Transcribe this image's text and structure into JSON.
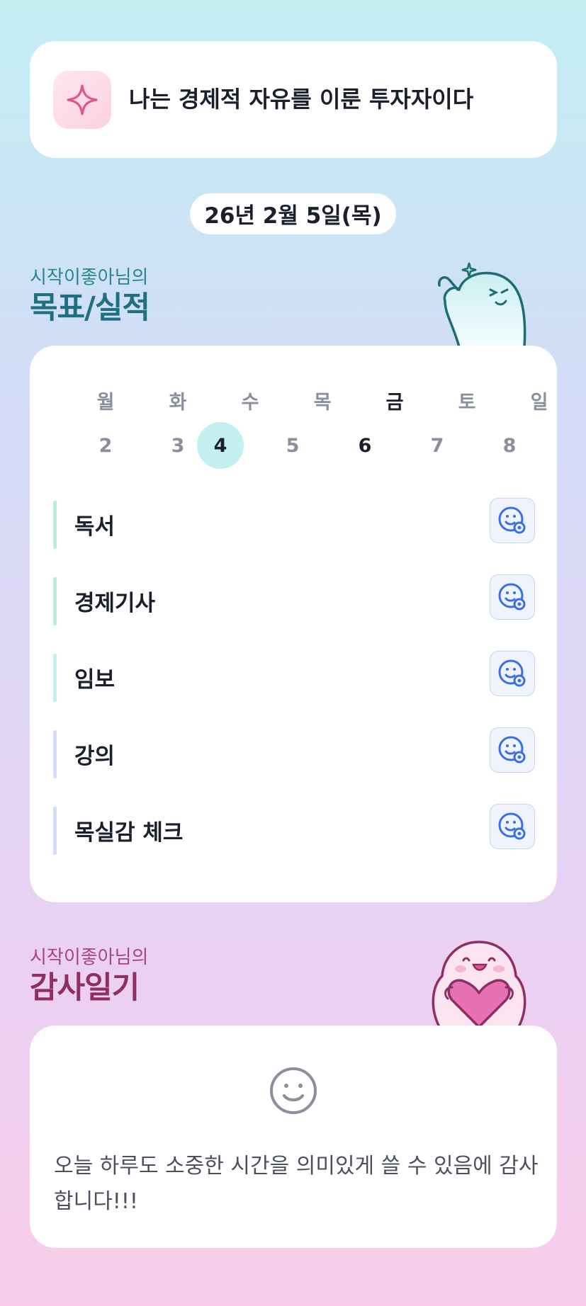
{
  "affirmation": {
    "text": "나는 경제적 자유를 이룬 투자자이다",
    "icon": "sparkle-icon"
  },
  "date": {
    "label": "26년 2월 5일(목)"
  },
  "goals_section": {
    "subtitle": "시작이좋아님의",
    "title": "목표/실적"
  },
  "week": {
    "days": [
      "월",
      "화",
      "수",
      "목",
      "금",
      "토",
      "일"
    ],
    "dates": [
      "2",
      "3",
      "4",
      "5",
      "6",
      "7",
      "8"
    ],
    "selected_index": 2,
    "today_index": 4
  },
  "goals": [
    {
      "label": "독서",
      "bar_color": "#b6eed7",
      "icon": "smile-add-icon"
    },
    {
      "label": "경제기사",
      "bar_color": "#b6eed7",
      "icon": "smile-add-icon"
    },
    {
      "label": "임보",
      "bar_color": "#c3eef2",
      "icon": "smile-add-icon"
    },
    {
      "label": "강의",
      "bar_color": "#d4dcf8",
      "icon": "smile-add-icon"
    },
    {
      "label": "목실감 체크",
      "bar_color": "#d4dcf8",
      "icon": "smile-add-icon"
    }
  ],
  "gratitude_section": {
    "subtitle": "시작이좋아님의",
    "title": "감사일기"
  },
  "gratitude": {
    "icon": "smile-icon",
    "text": "오늘 하루도 소중한 시간을 의미있게 쓸 수 있음에 감사합니다!!!"
  },
  "colors": {
    "accent_mint": "#c3eff2",
    "icon_blue": "#3b6fe0",
    "goal_title": "#1e7080",
    "thanks_title": "#8e2e63"
  }
}
